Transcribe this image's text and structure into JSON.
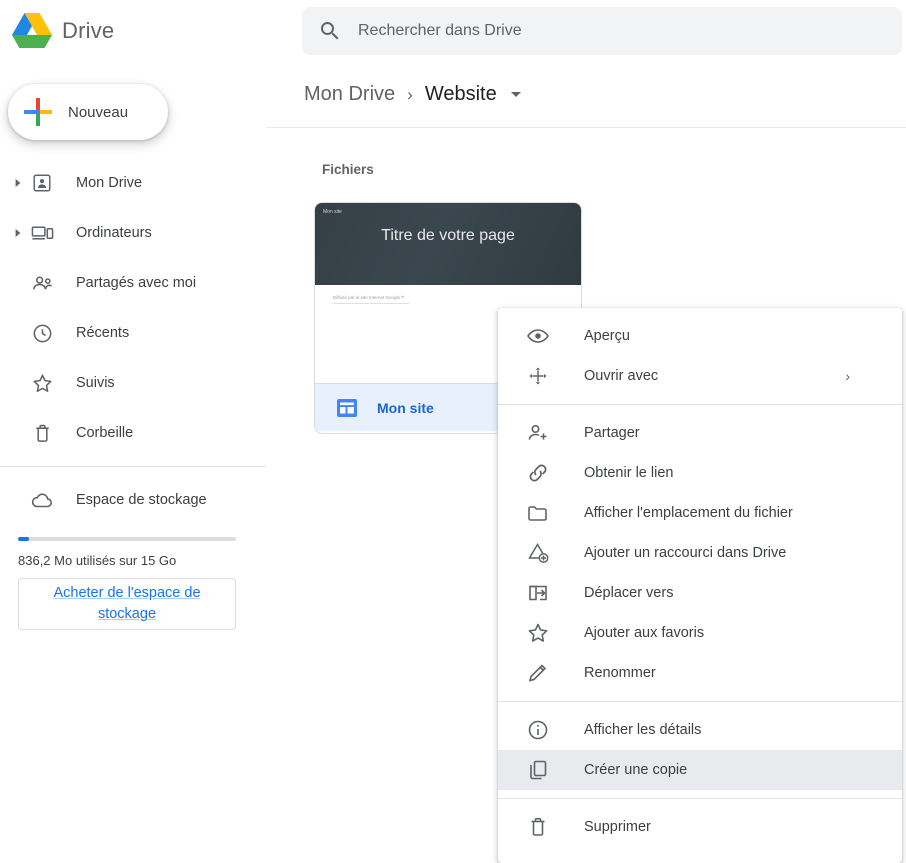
{
  "header": {
    "brand_title": "Drive",
    "logo_icon": "drive-triangle-logo",
    "search": {
      "icon": "search-icon",
      "placeholder": "Rechercher dans Drive",
      "value": ""
    }
  },
  "sidebar": {
    "new_button": {
      "label": "Nouveau",
      "icon": "plus-icon"
    },
    "items": [
      {
        "label": "Mon Drive",
        "icon": "my-drive-icon",
        "expandable": true
      },
      {
        "label": "Ordinateurs",
        "icon": "computers-icon",
        "expandable": true
      },
      {
        "label": "Partagés avec moi",
        "icon": "shared-with-me-icon",
        "expandable": false
      },
      {
        "label": "Récents",
        "icon": "recent-clock-icon",
        "expandable": false
      },
      {
        "label": "Suivis",
        "icon": "star-icon",
        "expandable": false
      },
      {
        "label": "Corbeille",
        "icon": "trash-icon",
        "expandable": false
      },
      {
        "label": "Espace de stockage",
        "icon": "cloud-icon",
        "expandable": false
      }
    ],
    "storage": {
      "used_percent": 5,
      "text": "836,2 Mo utilisés sur 15 Go",
      "buy_label": "Acheter de l'espace de stockage"
    }
  },
  "main": {
    "breadcrumb": {
      "root": "Mon Drive",
      "separator": "›",
      "current": "Website",
      "caret_icon": "chevron-down-icon"
    },
    "section_title": "Fichiers",
    "file_card": {
      "thumb_small_label": "Mon site",
      "thumb_title": "Titre de votre page",
      "thumb_sub": "Diffusé par le site Internet Google™",
      "name": "Mon site",
      "file_icon": "google-sites-icon"
    }
  },
  "context_menu": {
    "groups": [
      {
        "items": [
          {
            "label": "Aperçu",
            "icon": "eye-icon",
            "submenu": false
          },
          {
            "label": "Ouvrir avec",
            "icon": "open-with-icon",
            "submenu": true,
            "arrow": "›"
          }
        ]
      },
      {
        "items": [
          {
            "label": "Partager",
            "icon": "person-add-icon",
            "submenu": false
          },
          {
            "label": "Obtenir le lien",
            "icon": "link-icon",
            "submenu": false
          },
          {
            "label": "Afficher l'emplacement du fichier",
            "icon": "folder-icon",
            "submenu": false
          },
          {
            "label": "Ajouter un raccourci dans Drive",
            "icon": "shortcut-add-icon",
            "submenu": false
          },
          {
            "label": "Déplacer vers",
            "icon": "move-to-icon",
            "submenu": false
          },
          {
            "label": "Ajouter aux favoris",
            "icon": "star-icon",
            "submenu": false
          },
          {
            "label": "Renommer",
            "icon": "pencil-icon",
            "submenu": false
          }
        ]
      },
      {
        "items": [
          {
            "label": "Afficher les détails",
            "icon": "info-icon",
            "submenu": false
          },
          {
            "label": "Créer une copie",
            "icon": "copy-icon",
            "submenu": false,
            "highlighted": true
          }
        ]
      },
      {
        "items": [
          {
            "label": "Supprimer",
            "icon": "trash-icon",
            "submenu": false
          }
        ]
      }
    ]
  },
  "colors": {
    "accent_blue": "#1a73e8",
    "selected_bg": "#e8f0fe",
    "menu_highlight": "#e8eaed",
    "text_primary": "#202124",
    "text_secondary": "#5f6368"
  }
}
